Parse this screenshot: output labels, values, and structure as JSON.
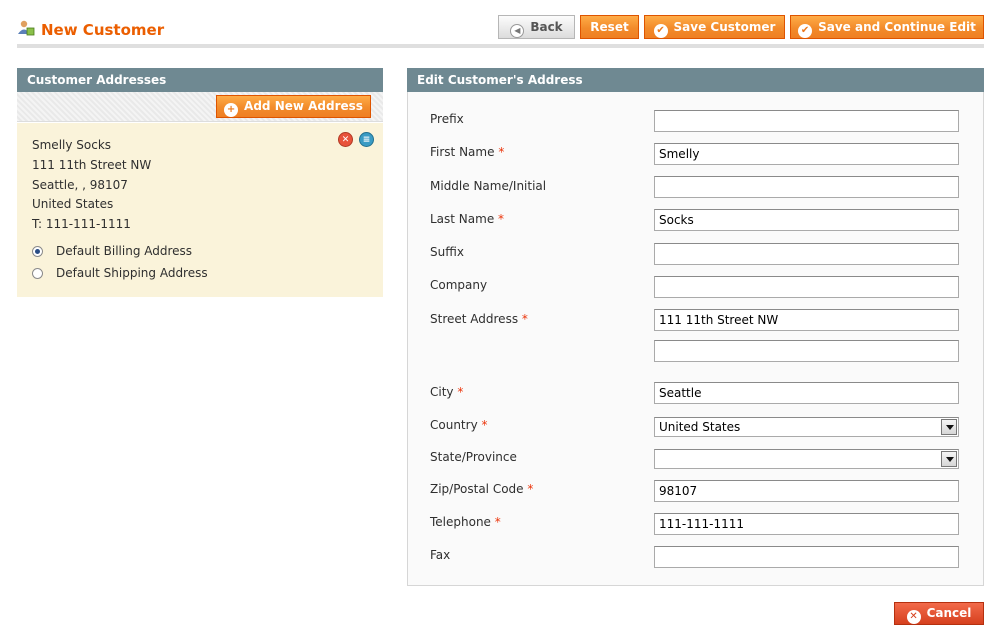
{
  "header": {
    "title": "New Customer",
    "icon": "customer-icon",
    "buttons": {
      "back": "Back",
      "reset": "Reset",
      "save": "Save Customer",
      "save_continue": "Save and Continue Edit"
    }
  },
  "addresses_panel": {
    "title": "Customer Addresses",
    "add_button": "Add New Address",
    "address": {
      "lines": [
        "Smelly Socks",
        "111 11th Street NW",
        "Seattle, , 98107",
        "United States",
        "T: 111-111-1111"
      ],
      "default_billing_label": "Default Billing Address",
      "default_billing_checked": true,
      "default_shipping_label": "Default Shipping Address",
      "default_shipping_checked": false
    }
  },
  "edit_panel": {
    "title": "Edit Customer's Address",
    "fields": {
      "prefix": {
        "label": "Prefix",
        "value": ""
      },
      "first_name": {
        "label": "First Name",
        "value": "Smelly",
        "required": true
      },
      "middle_name": {
        "label": "Middle Name/Initial",
        "value": ""
      },
      "last_name": {
        "label": "Last Name",
        "value": "Socks",
        "required": true
      },
      "suffix": {
        "label": "Suffix",
        "value": ""
      },
      "company": {
        "label": "Company",
        "value": ""
      },
      "street": {
        "label": "Street Address",
        "value": "111 11th Street NW",
        "value2": "",
        "required": true
      },
      "city": {
        "label": "City",
        "value": "Seattle",
        "required": true
      },
      "country": {
        "label": "Country",
        "value": "United States",
        "required": true
      },
      "state": {
        "label": "State/Province",
        "value": ""
      },
      "zip": {
        "label": "Zip/Postal Code",
        "value": "98107",
        "required": true
      },
      "telephone": {
        "label": "Telephone",
        "value": "111-111-1111",
        "required": true
      },
      "fax": {
        "label": "Fax",
        "value": ""
      }
    },
    "required_mark": "*",
    "cancel_button": "Cancel"
  },
  "colors": {
    "accent": "#eb5e00",
    "button_orange": "#f28b2b",
    "panel_header": "#6f8992",
    "address_bg": "#faf3da"
  }
}
